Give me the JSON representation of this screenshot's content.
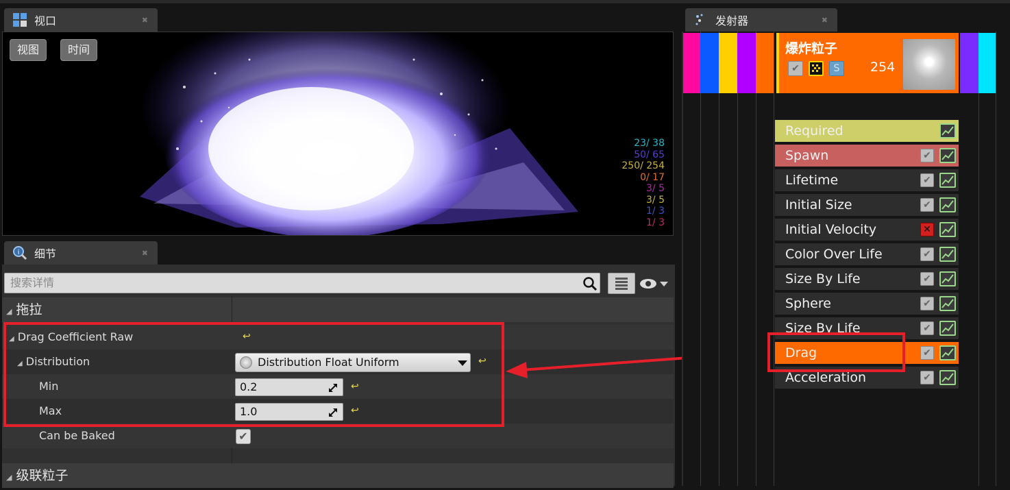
{
  "viewport": {
    "tab_title": "视口",
    "buttons": [
      "视图",
      "时间"
    ],
    "stats": [
      {
        "text": "23/ 38",
        "color": "#26b6c6"
      },
      {
        "text": "50/ 65",
        "color": "#5a3bd6"
      },
      {
        "text": "250/ 254",
        "color": "#c8b43c"
      },
      {
        "text": "0/ 17",
        "color": "#e0702a"
      },
      {
        "text": "3/ 5",
        "color": "#b02aa8"
      },
      {
        "text": "3/ 5",
        "color": "#c8b43c"
      },
      {
        "text": "1/ 3",
        "color": "#3a54c8"
      },
      {
        "text": "1/ 3",
        "color": "#c22a6a"
      }
    ]
  },
  "details": {
    "tab_title": "细节",
    "search_placeholder": "搜索详情",
    "category_drag": "拖拉",
    "drag_coefficient_label": "Drag Coefficient Raw",
    "distribution_label": "Distribution",
    "distribution_value": "Distribution Float Uniform",
    "min_label": "Min",
    "min_value": "0.2",
    "max_label": "Max",
    "max_value": "1.0",
    "can_be_baked_label": "Can be Baked",
    "can_be_baked_checked": true,
    "category_cascade": "级联粒子",
    "reset_icon": "↩"
  },
  "emitter": {
    "tab_title": "发射器",
    "name": "爆炸粒子",
    "particle_count": "254",
    "solo_label": "S",
    "color_swatches": [
      "#ff0aa0",
      "#0a5aff",
      "#ffd000",
      "#b000ff",
      "#ff6a00",
      "#7a2cff",
      "#00e5ff"
    ],
    "modules": [
      {
        "label": "Required",
        "bg": "#cfcf6a",
        "has_check": false,
        "check": "none"
      },
      {
        "label": "Spawn",
        "bg": "#c96060",
        "has_check": true,
        "check": "on"
      },
      {
        "label": "Lifetime",
        "bg": "#2d2d2d",
        "has_check": true,
        "check": "on"
      },
      {
        "label": "Initial Size",
        "bg": "#2d2d2d",
        "has_check": true,
        "check": "on"
      },
      {
        "label": "Initial Velocity",
        "bg": "#2d2d2d",
        "has_check": true,
        "check": "off"
      },
      {
        "label": "Color Over Life",
        "bg": "#2d2d2d",
        "has_check": true,
        "check": "on"
      },
      {
        "label": "Size By Life",
        "bg": "#2d2d2d",
        "has_check": true,
        "check": "on"
      },
      {
        "label": "Sphere",
        "bg": "#2d2d2d",
        "has_check": true,
        "check": "on"
      },
      {
        "label": "Size By Life",
        "bg": "#2d2d2d",
        "has_check": true,
        "check": "on"
      },
      {
        "label": "Drag",
        "bg": "#ff6a00",
        "has_check": true,
        "check": "on"
      },
      {
        "label": "Acceleration",
        "bg": "#2d2d2d",
        "has_check": true,
        "check": "on"
      }
    ]
  },
  "annotation_color": "#e5202a"
}
